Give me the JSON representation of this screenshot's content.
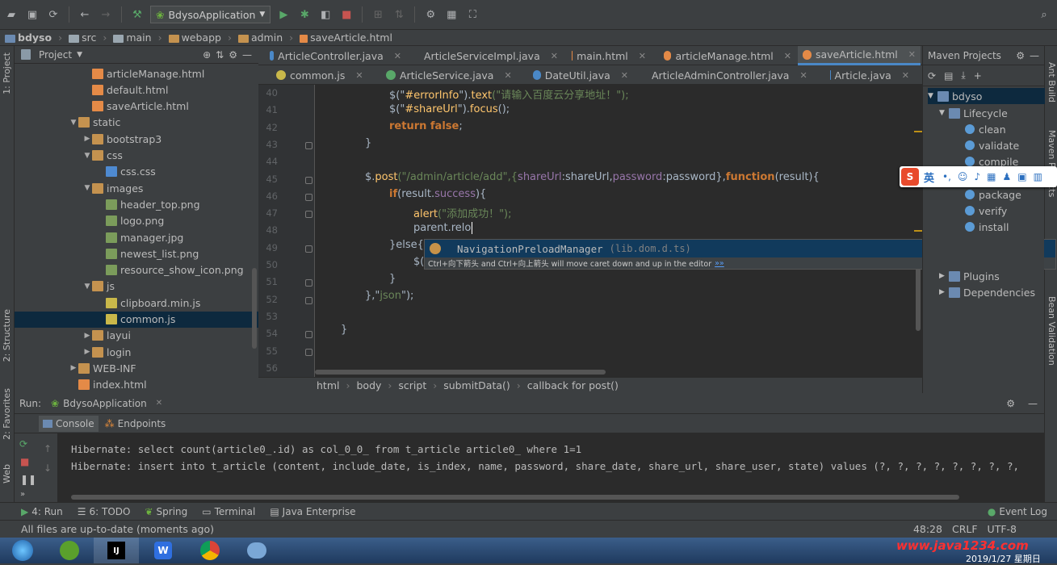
{
  "toolbar": {
    "run_config": "BdysoApplication"
  },
  "breadcrumb": [
    "bdyso",
    "src",
    "main",
    "webapp",
    "admin",
    "saveArticle.html"
  ],
  "left_strip": {
    "project": "1: Project",
    "structure": "2: Structure",
    "favorites": "2: Favorites",
    "web": "Web"
  },
  "right_strip": {
    "ant": "Ant Build",
    "maven": "Maven Projects",
    "bean": "Bean Validation"
  },
  "project": {
    "header": "Project",
    "items": [
      {
        "label": "articleManage.html",
        "type": "html"
      },
      {
        "label": "default.html",
        "type": "html"
      },
      {
        "label": "saveArticle.html",
        "type": "html"
      },
      {
        "label": "static",
        "type": "folder"
      },
      {
        "label": "bootstrap3",
        "type": "folder"
      },
      {
        "label": "css",
        "type": "folder"
      },
      {
        "label": "css.css",
        "type": "css"
      },
      {
        "label": "images",
        "type": "folder"
      },
      {
        "label": "header_top.png",
        "type": "png"
      },
      {
        "label": "logo.png",
        "type": "png"
      },
      {
        "label": "manager.jpg",
        "type": "png"
      },
      {
        "label": "newest_list.png",
        "type": "png"
      },
      {
        "label": "resource_show_icon.png",
        "type": "png"
      },
      {
        "label": "js",
        "type": "folder"
      },
      {
        "label": "clipboard.min.js",
        "type": "js"
      },
      {
        "label": "common.js",
        "type": "js"
      },
      {
        "label": "layui",
        "type": "folder"
      },
      {
        "label": "login",
        "type": "folder"
      },
      {
        "label": "WEB-INF",
        "type": "folder"
      },
      {
        "label": "index.html",
        "type": "html"
      }
    ]
  },
  "tabs_row1": [
    "ArticleController.java",
    "ArticleServiceImpl.java",
    "main.html",
    "articleManage.html",
    "saveArticle.html"
  ],
  "tabs_row2": [
    "common.js",
    "ArticleService.java",
    "DateUtil.java",
    "ArticleAdminController.java",
    "Article.java"
  ],
  "code": {
    "line_numbers": [
      "40",
      "41",
      "42",
      "43",
      "44",
      "45",
      "46",
      "47",
      "48",
      "49",
      "50",
      "51",
      "52",
      "53",
      "54",
      "55",
      "56"
    ],
    "l40a": "$(\"",
    "l40b": "#errorInfo",
    "l40c": "\").",
    "l40d": "text",
    "l40e": "(\"请输入百度云分享地址！\");",
    "l41a": "$(\"",
    "l41b": "#shareUrl",
    "l41c": "\").",
    "l41d": "focus",
    "l41e": "();",
    "l42a": "return false",
    "l42b": ";",
    "l43": "}",
    "l45a": "$.",
    "l45b": "post",
    "l45c": "(\"/admin/article/add\",{",
    "l45d": "shareUrl",
    "l45e": ":shareUrl,",
    "l45f": "password",
    "l45g": ":password},",
    "l45h": "function",
    "l45i": "(result){",
    "l46a": "if",
    "l46b": "(result.",
    "l46c": "success",
    "l46d": "){",
    "l47a": "alert",
    "l47b": "(\"添加成功！\");",
    "l48": "parent.relo",
    "l49a": "}else{",
    "l50": "$(",
    "l51": "}",
    "l52a": "},\"",
    "l52b": "json",
    "l52c": "\");",
    "l54": "}"
  },
  "autocomplete": {
    "item_prefix": "NavigationPrel",
    "item_match": "o",
    "item_suffix": "adManager",
    "item_source": "(lib.dom.d.ts)",
    "hint": "Ctrl+向下箭头 and Ctrl+向上箭头 will move caret down and up in the editor",
    "hint_link": "»»"
  },
  "editor_crumbs": [
    "html",
    "body",
    "script",
    "submitData()",
    "callback for post()"
  ],
  "maven": {
    "header": "Maven Projects",
    "root": "bdyso",
    "lifecycle": "Lifecycle",
    "goals": [
      "clean",
      "validate",
      "compile",
      "package",
      "verify",
      "install"
    ],
    "plugins": "Plugins",
    "dependencies": "Dependencies"
  },
  "ime": {
    "mode": "英"
  },
  "run": {
    "label": "Run:",
    "app": "BdysoApplication",
    "console_tab": "Console",
    "endpoints_tab": "Endpoints",
    "lines": [
      "Hibernate: select count(article0_.id) as col_0_0_ from t_article article0_ where 1=1",
      "Hibernate: insert into t_article (content, include_date, is_index, name, password, share_date, share_url, share_user, state) values (?, ?, ?, ?, ?, ?, ?, ?,"
    ]
  },
  "bottom_tabs": [
    "4: Run",
    "6: TODO",
    "Spring",
    "Terminal",
    "Java Enterprise"
  ],
  "event_log": "Event Log",
  "status": {
    "message": "All files are up-to-date (moments ago)",
    "position": "48:28",
    "line_sep": "CRLF",
    "encoding": "UTF-8"
  },
  "taskbar": {
    "watermark": "www.java1234.com",
    "date": "2019/1/27 星期日"
  },
  "colors": {
    "bg": "#2b2b2b",
    "panel": "#3c3f41",
    "selection": "#0d293e",
    "accent": "#4a88c7"
  }
}
